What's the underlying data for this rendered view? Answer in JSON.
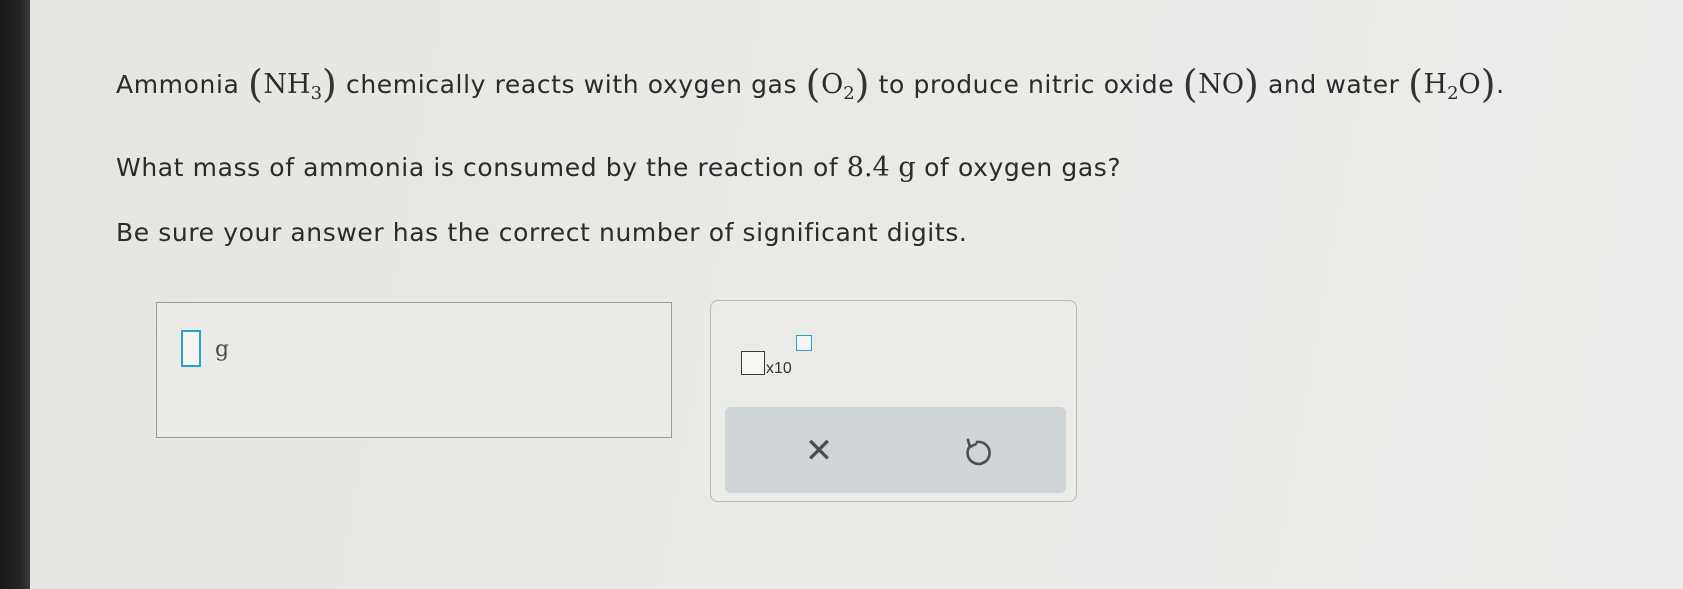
{
  "question": {
    "line1": {
      "text_ammonia": "Ammonia",
      "formula_nh3_main": "NH",
      "formula_nh3_sub": "3",
      "text_reacts": "chemically reacts with oxygen gas",
      "formula_o2_main": "O",
      "formula_o2_sub": "2",
      "text_produce": "to produce nitric oxide",
      "formula_no": "NO",
      "text_water": "and water",
      "formula_h2o_h": "H",
      "formula_h2o_sub": "2",
      "formula_h2o_o": "O",
      "period": "."
    },
    "line2": {
      "text_before": "What mass of ammonia is consumed by the reaction of",
      "quantity": "8.4 g",
      "text_after": "of oxygen gas?"
    },
    "line3": "Be sure your answer has the correct number of significant digits."
  },
  "answer": {
    "value": "",
    "unit": "g"
  },
  "tools": {
    "sci_notation_label": "x10",
    "clear_symbol": "✕",
    "undo_icon": "undo-icon"
  },
  "colors": {
    "accent": "#2f9fd1",
    "action_bar": "#cfd4d6"
  }
}
